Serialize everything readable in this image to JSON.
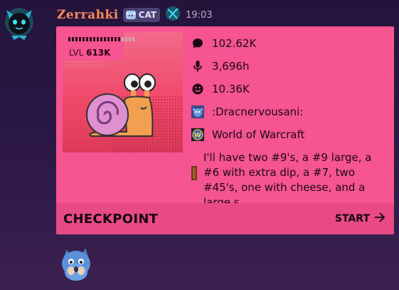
{
  "message": {
    "username": "Zerrahki",
    "tag_label": "CAT",
    "timestamp": "19:03"
  },
  "card": {
    "level_label": "LVL",
    "level_value": "613K",
    "stats": {
      "messages": "102.62K",
      "voice_hours": "3,696h",
      "reactions": "10.36K",
      "emoji": ":Dracnervousani:",
      "game": "World of Warcraft",
      "last_message": "I'll have two #9's, a #9 large, a #6 with extra dip, a #7, two #45's, one with cheese, and a large s"
    },
    "icons": {
      "messages": "speech-bubble-icon",
      "voice": "microphone-icon",
      "reactions": "smiley-icon",
      "emoji": "dragon-emoji-icon",
      "game": "world-of-warcraft-icon",
      "message": "message-marker-icon"
    },
    "footer": {
      "brand": "CHECKPOINT",
      "start_label": "START"
    }
  },
  "colors": {
    "background": "#2a1744",
    "username": "#ff8a5c",
    "card": "#f75591",
    "footer": "#e84a85"
  }
}
